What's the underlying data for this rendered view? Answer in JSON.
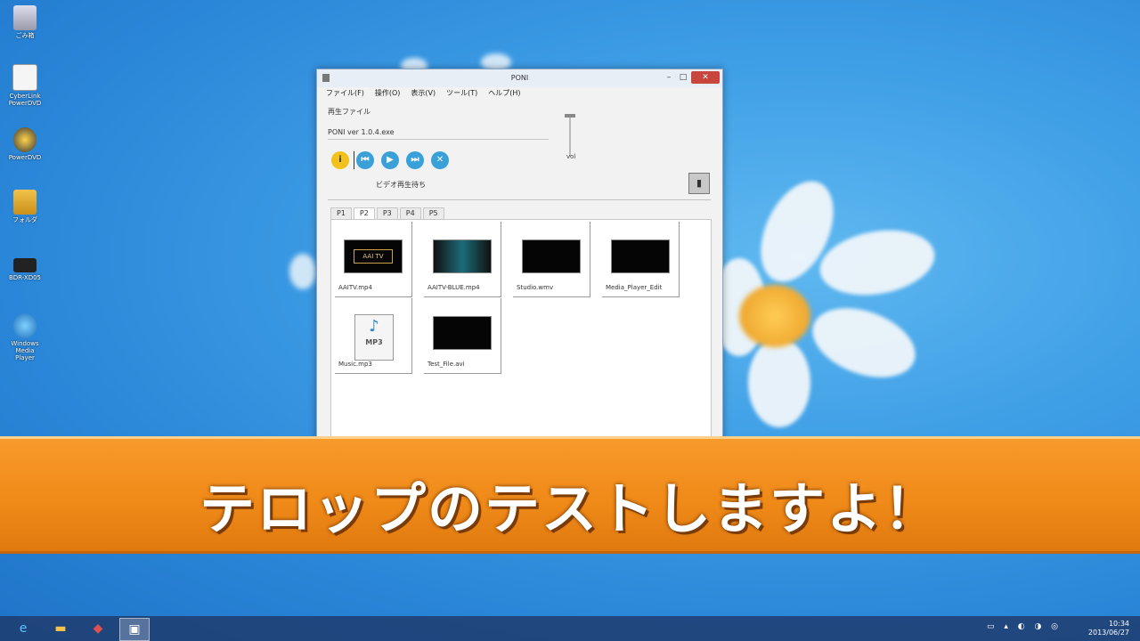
{
  "desktop": {
    "icons": [
      {
        "label": "ごみ箱",
        "icon": "recycle-bin-icon"
      },
      {
        "label": "CyberLink PowerDVD",
        "icon": "document-icon"
      },
      {
        "label": "PowerDVD",
        "icon": "dvd-player-icon"
      },
      {
        "label": "フォルダ",
        "icon": "folder-icon"
      },
      {
        "label": "BDR-XD05",
        "icon": "drive-icon"
      },
      {
        "label": "Windows Media Player",
        "icon": "media-player-icon"
      }
    ]
  },
  "window": {
    "title": "PONI",
    "min": "–",
    "max": "□",
    "close": "✕",
    "menu": [
      "ファイル(F)",
      "操作(O)",
      "表示(V)",
      "ツール(T)",
      "ヘルプ(H)"
    ],
    "label_now_playing": "再生ファイル",
    "current_file": "PONI ver 1.0.4.exe",
    "volume": "vol",
    "controls": [
      "i",
      "⏮",
      "▶",
      "⏭",
      "✕"
    ],
    "status": "ビデオ再生待ち",
    "side_button": "▮",
    "tabs": [
      "P1",
      "P2",
      "P3",
      "P4",
      "P5"
    ],
    "active_tab": 1,
    "items": [
      {
        "name": "AAITV.mp4",
        "type": "video",
        "badge": "AAI TV"
      },
      {
        "name": "AAITV-BLUE.mp4",
        "type": "video",
        "badge": ""
      },
      {
        "name": "Studio.wmv",
        "type": "video",
        "badge": ""
      },
      {
        "name": "Media_Player_Edit",
        "type": "video",
        "badge": ""
      },
      {
        "name": "Music.mp3",
        "type": "audio",
        "badge": "MP3"
      },
      {
        "name": "Test_File.avi",
        "type": "video",
        "badge": ""
      }
    ]
  },
  "banner": {
    "text": "テロップのテストしますよ！"
  },
  "taskbar": {
    "apps": [
      {
        "icon": "ie-icon",
        "glyph": "e"
      },
      {
        "icon": "explorer-icon",
        "glyph": "▬"
      },
      {
        "icon": "toolbox-icon",
        "glyph": "◆"
      },
      {
        "icon": "app-icon",
        "glyph": "▣"
      }
    ],
    "time": "10:34",
    "date": "2013/06/27"
  }
}
